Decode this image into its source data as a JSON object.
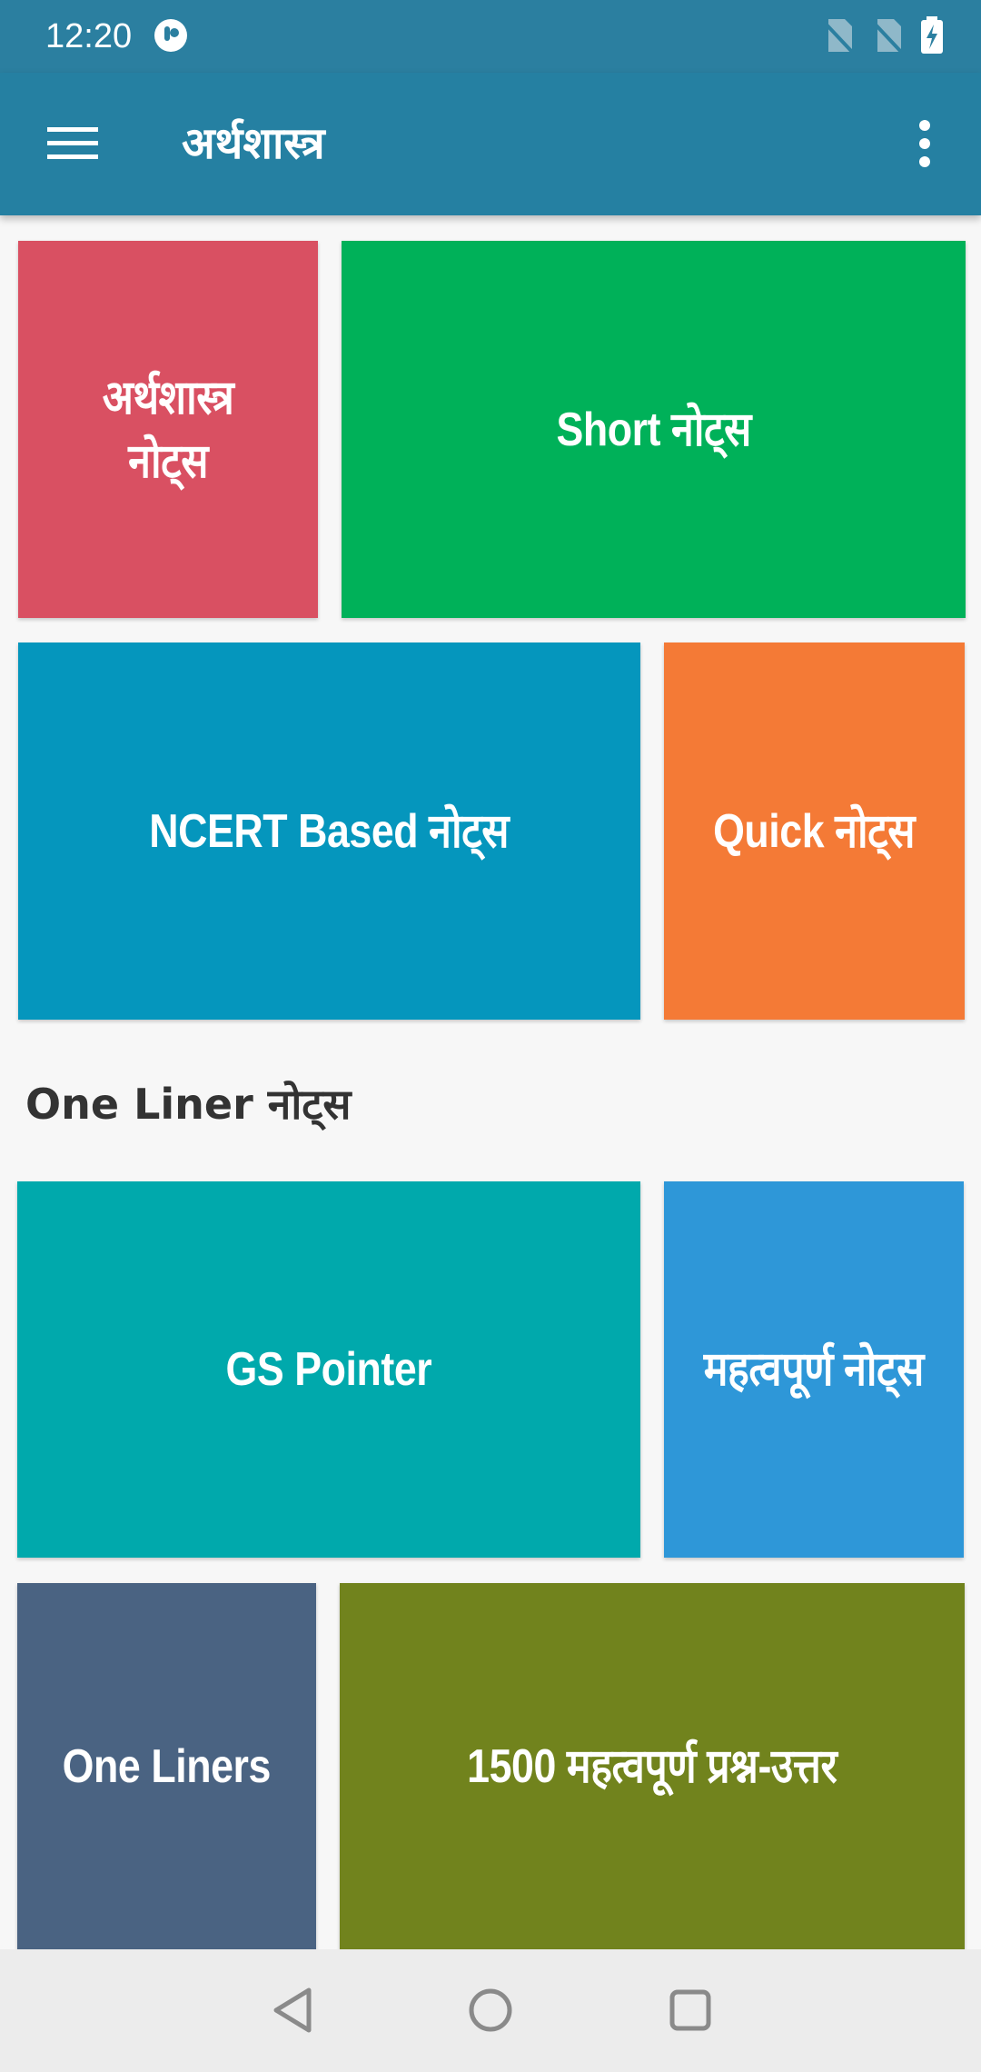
{
  "status_bar": {
    "time": "12:20"
  },
  "app_bar": {
    "title": "अर्थशास्त्र",
    "menu_icon": "hamburger-menu-icon",
    "overflow_icon": "more-vertical-icon"
  },
  "tiles": {
    "economics_notes": {
      "label": "अर्थशास्त्र\nनोट्स",
      "color": "#d95062"
    },
    "short_notes": {
      "label": "Short नोट्स",
      "color": "#00b159"
    },
    "ncert_notes": {
      "label": "NCERT Based नोट्स",
      "color": "#0596bd"
    },
    "quick_notes": {
      "label": "Quick नोट्स",
      "color": "#f47a36"
    },
    "gs_pointer": {
      "label": "GS Pointer",
      "color": "#00a9ac"
    },
    "important_notes": {
      "label": "महत्वपूर्ण नोट्स",
      "color": "#2e97d8"
    },
    "one_liners": {
      "label": "One Liners",
      "color": "#4a6382"
    },
    "qa_1500": {
      "label": "1500 महत्वपूर्ण प्रश्न-उत्तर",
      "color": "#71831d"
    }
  },
  "section": {
    "one_liner_heading": "One Liner नोट्स"
  },
  "nav_bar": {
    "back_icon": "back-triangle-icon",
    "home_icon": "home-circle-icon",
    "recents_icon": "recents-square-icon"
  }
}
